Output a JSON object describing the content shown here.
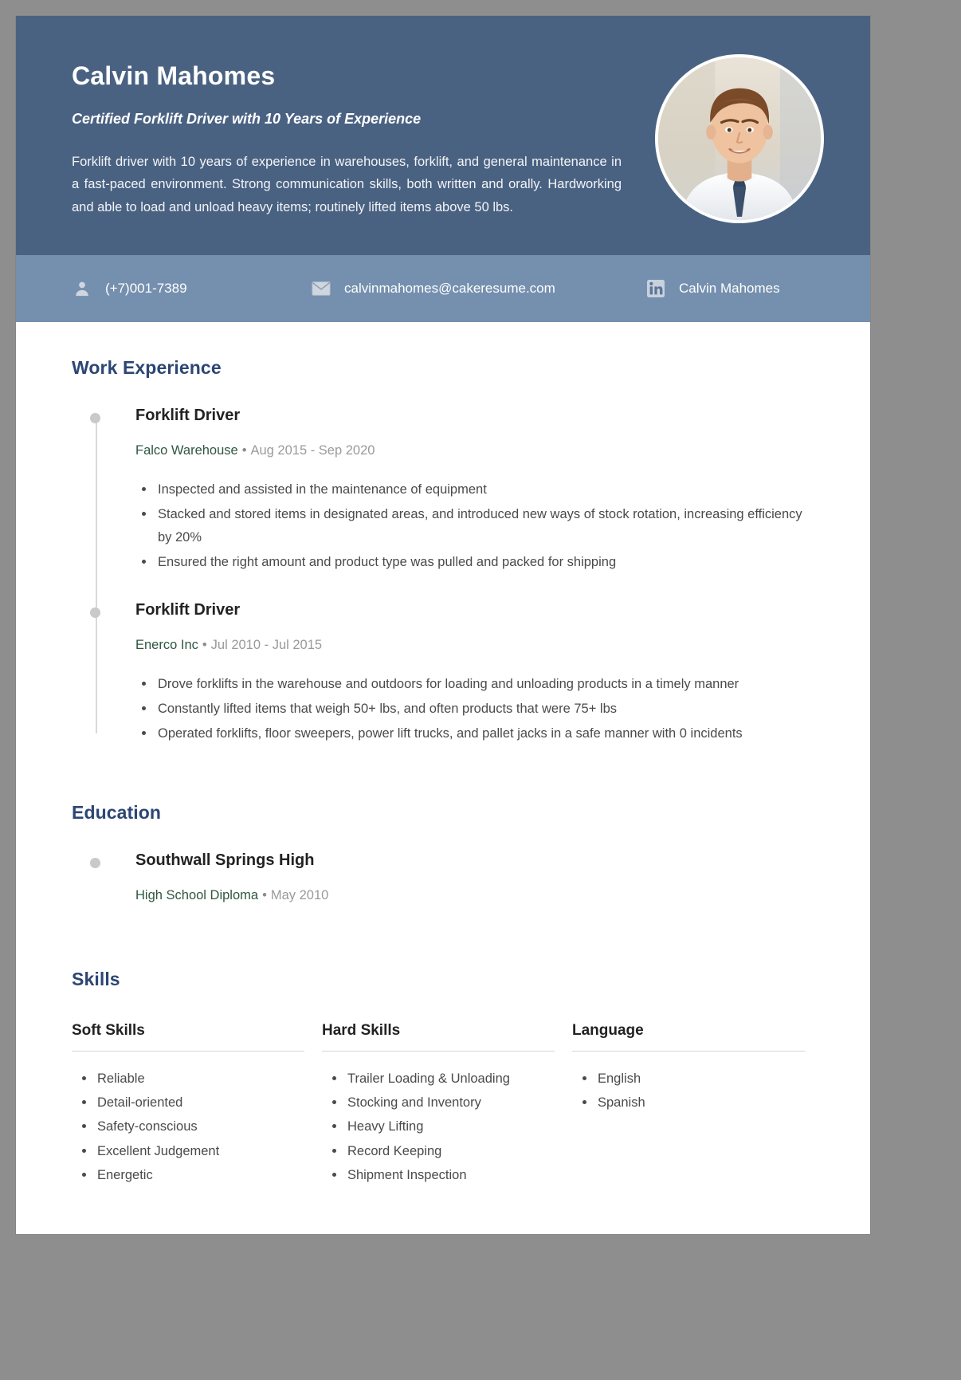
{
  "colors": {
    "header_bg": "#4a6282",
    "contact_bg": "#7590ae",
    "section_heading": "#2c4674",
    "org_green": "#2f5740",
    "date_gray": "#9a9a9a",
    "page_bg": "#8e8e8e"
  },
  "header": {
    "name": "Calvin Mahomes",
    "headline": "Certified Forklift Driver with 10 Years of Experience",
    "summary": "Forklift driver with 10 years of experience in warehouses, forklift, and general maintenance in a fast-paced environment. Strong communication skills, both written and orally. Hardworking and able to load and unload heavy items; routinely lifted items above 50 lbs.",
    "avatar_alt": "profile-photo"
  },
  "contact": {
    "items": [
      {
        "icon": "person-icon",
        "value": "(+7)001-7389"
      },
      {
        "icon": "envelope-icon",
        "value": "calvinmahomes@cakeresume.com"
      },
      {
        "icon": "linkedin-icon",
        "value": "Calvin Mahomes"
      }
    ]
  },
  "sections": {
    "work": {
      "title": "Work Experience",
      "entries": [
        {
          "title": "Forklift Driver",
          "organization": "Falco Warehouse",
          "separator": "•",
          "dates": "Aug 2015 - Sep 2020",
          "bullets": [
            "Inspected and assisted in the maintenance of equipment",
            "Stacked and stored items in designated areas, and introduced new ways of stock rotation, increasing efficiency by 20%",
            "Ensured the right amount and product type was pulled and packed for shipping"
          ]
        },
        {
          "title": "Forklift Driver",
          "organization": "Enerco Inc",
          "separator": "•",
          "dates": "Jul 2010 - Jul 2015",
          "bullets": [
            "Drove forklifts in the warehouse and outdoors for loading and unloading products in a timely manner",
            "Constantly lifted items that weigh 50+ lbs, and often products that were 75+ lbs",
            "Operated forklifts, floor sweepers, power lift trucks, and pallet jacks in a safe manner with 0 incidents"
          ]
        }
      ]
    },
    "education": {
      "title": "Education",
      "entries": [
        {
          "title": "Southwall Springs High",
          "organization": "High School Diploma",
          "separator": "•",
          "dates": "May 2010"
        }
      ]
    },
    "skills": {
      "title": "Skills",
      "columns": [
        {
          "heading": "Soft Skills",
          "items": [
            "Reliable",
            "Detail-oriented",
            "Safety-conscious",
            "Excellent Judgement",
            "Energetic"
          ]
        },
        {
          "heading": "Hard Skills",
          "items": [
            "Trailer Loading & Unloading",
            "Stocking and Inventory",
            "Heavy Lifting",
            "Record Keeping",
            "Shipment Inspection"
          ]
        },
        {
          "heading": "Language",
          "items": [
            "English",
            "Spanish"
          ]
        }
      ]
    }
  }
}
